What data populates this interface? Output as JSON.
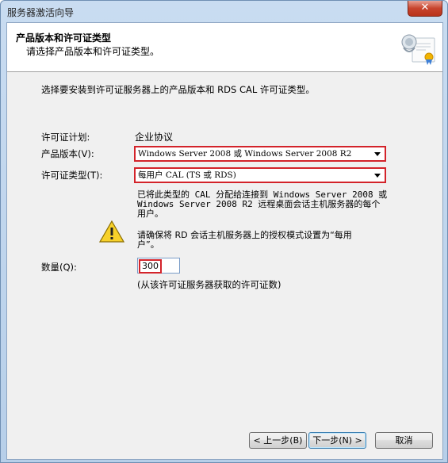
{
  "window": {
    "title": "服务器激活向导",
    "close_label": "✕"
  },
  "header": {
    "title": "产品版本和许可证类型",
    "subtitle": "请选择产品版本和许可证类型。",
    "icon": "certificate-icon"
  },
  "body": {
    "intro": "选择要安装到许可证服务器上的产品版本和 RDS CAL 许可证类型。",
    "license_program": {
      "label": "许可证计划:",
      "value": "企业协议"
    },
    "product_version": {
      "label": "产品版本(V):",
      "selected": "Windows Server 2008 或 Windows Server 2008 R2"
    },
    "license_type": {
      "label": "许可证类型(T):",
      "selected": "每用户 CAL (TS 或 RDS)"
    },
    "description_lines": [
      "已将此类型的 CAL 分配给连接到 Windows Server 2008 或",
      "Windows Server 2008 R2 远程桌面会话主机服务器的每个",
      "用户。"
    ],
    "warning_lines": [
      "请确保将 RD 会话主机服务器上的授权模式设置为“每用",
      "户”。"
    ],
    "warning_icon": "warning-icon",
    "quantity": {
      "label": "数量(Q):",
      "value": "300",
      "hint": "(从该许可证服务器获取的许可证数)"
    }
  },
  "buttons": {
    "back": "< 上一步(B)",
    "next": "下一步(N) >",
    "cancel": "取消"
  },
  "colors": {
    "highlight": "#d3232a",
    "titlebar": "#b7cfe9"
  }
}
